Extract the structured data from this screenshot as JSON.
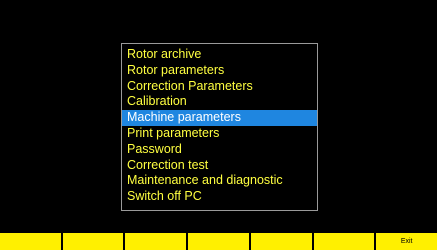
{
  "menu": {
    "items": [
      {
        "label": "Rotor archive",
        "selected": false
      },
      {
        "label": "Rotor parameters",
        "selected": false
      },
      {
        "label": "Correction Parameters",
        "selected": false
      },
      {
        "label": "Calibration",
        "selected": false
      },
      {
        "label": "Machine parameters",
        "selected": true
      },
      {
        "label": "Print parameters",
        "selected": false
      },
      {
        "label": "Password",
        "selected": false
      },
      {
        "label": "Correction test",
        "selected": false
      },
      {
        "label": "Maintenance and diagnostic",
        "selected": false
      },
      {
        "label": "Switch off PC",
        "selected": false
      }
    ]
  },
  "function_keys": [
    "",
    "",
    "",
    "",
    "",
    "",
    "Exit"
  ],
  "colors": {
    "background": "#000000",
    "menu_text": "#ffff40",
    "selection_bg": "#1f86e0",
    "selection_text": "#ffffff",
    "fkey_bg": "#fff000"
  }
}
